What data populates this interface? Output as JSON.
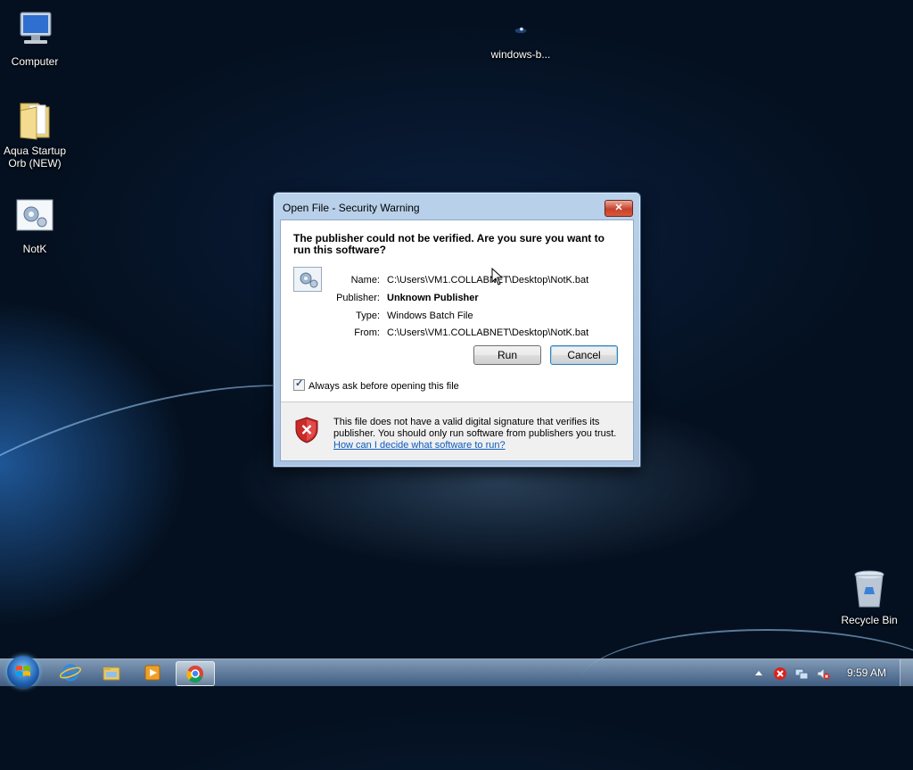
{
  "desktop": {
    "icons": [
      {
        "label": "Computer",
        "icon": "computer-icon"
      },
      {
        "label": "Aqua Startup Orb (NEW)",
        "icon": "folder-icon"
      },
      {
        "label": "NotK",
        "icon": "batch-file-icon"
      },
      {
        "label": "windows-b...",
        "icon": "image-file-icon"
      },
      {
        "label": "Recycle Bin",
        "icon": "recycle-bin-icon"
      }
    ]
  },
  "dialog": {
    "title": "Open File - Security Warning",
    "close_label": "✕",
    "heading": "The publisher could not be verified.  Are you sure you want to run this software?",
    "fields": {
      "name_label": "Name:",
      "name_value": "C:\\Users\\VM1.COLLABNET\\Desktop\\NotK.bat",
      "publisher_label": "Publisher:",
      "publisher_value": "Unknown Publisher",
      "type_label": "Type:",
      "type_value": "Windows Batch File",
      "from_label": "From:",
      "from_value": "C:\\Users\\VM1.COLLABNET\\Desktop\\NotK.bat"
    },
    "run_label": "Run",
    "cancel_label": "Cancel",
    "checkbox_label": "Always ask before opening this file",
    "checkbox_checked": true,
    "footer_text": "This file does not have a valid digital signature that verifies its publisher.  You should only run software from publishers you trust.",
    "footer_link": "How can I decide what software to run?"
  },
  "taskbar": {
    "pinned": [
      "internet-explorer-icon",
      "file-explorer-icon",
      "media-player-icon",
      "chrome-icon"
    ],
    "tray": [
      "show-hidden-icons-arrow",
      "action-center-icon",
      "network-icon",
      "volume-muted-icon"
    ],
    "clock": "9:59 AM"
  },
  "colors": {
    "accent": "#3c7fb1",
    "link": "#0b5bbf",
    "titlebar": "#b9d1ea",
    "close_button": "#c7422b"
  }
}
